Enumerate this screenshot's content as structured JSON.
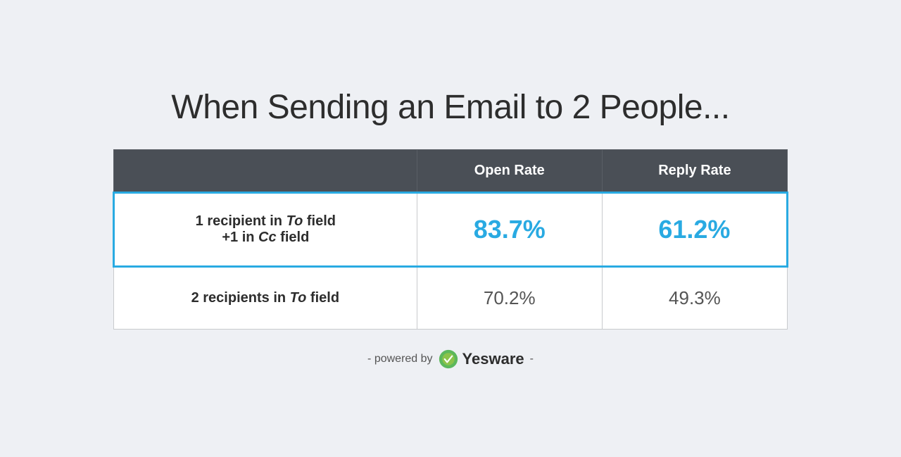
{
  "page": {
    "title": "When Sending an Email to 2 People...",
    "background_color": "#eef0f4"
  },
  "table": {
    "header": {
      "col1": "",
      "col2": "Open Rate",
      "col3": "Reply Rate"
    },
    "rows": [
      {
        "id": "row-highlighted",
        "col1_line1": "1 recipient in ",
        "col1_italic": "To",
        "col1_line1_suffix": " field",
        "col1_line2_prefix": "+1 in ",
        "col1_italic2": "Cc",
        "col1_line2_suffix": " field",
        "col1_full": "1 recipient in To field +1 in Cc field",
        "col2": "83.7%",
        "col3": "61.2%",
        "highlighted": true
      },
      {
        "id": "row-normal",
        "col1_prefix": "2 recipients in ",
        "col1_italic": "To",
        "col1_suffix": " field",
        "col1_full": "2 recipients in To field",
        "col2": "70.2%",
        "col3": "49.3%",
        "highlighted": false
      }
    ]
  },
  "footer": {
    "prefix": "- powered by",
    "brand": "Yesware",
    "suffix": "-",
    "logo_colors": {
      "outer": "#4caf50",
      "inner": "#8bc34a",
      "check": "#ffffff"
    }
  }
}
